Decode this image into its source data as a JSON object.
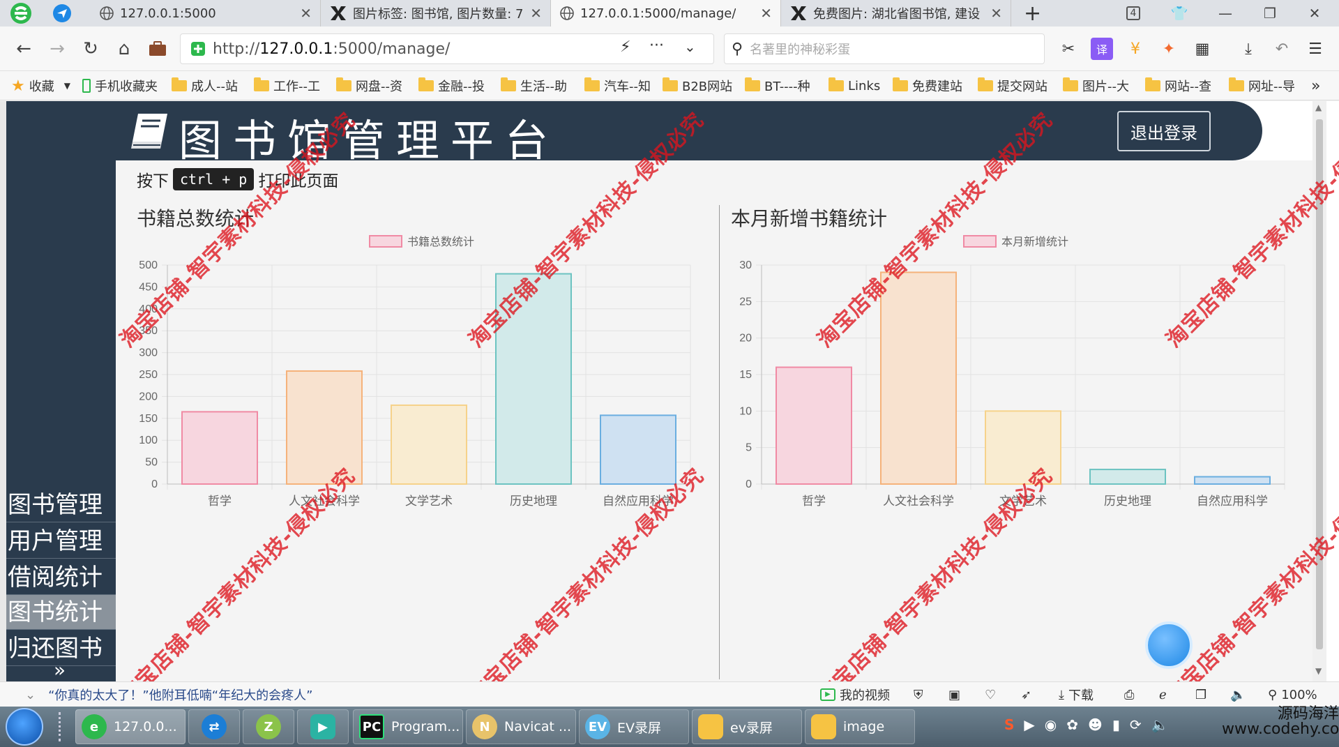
{
  "browser": {
    "tabs": [
      {
        "label": "127.0.0.1:5000",
        "icon": "globe-icon"
      },
      {
        "label": "图片标签: 图书馆, 图片数量: 7",
        "icon": "site-logo-icon"
      },
      {
        "label": "127.0.0.1:5000/manage/",
        "icon": "globe-icon"
      },
      {
        "label": "免费图片: 湖北省图书馆, 建设",
        "icon": "site-logo-icon"
      }
    ],
    "tab_counter": "4",
    "url_prefix": "http://",
    "url_host": "127.0.0.1",
    "url_rest": ":5000/manage/",
    "search_placeholder": "名著里的神秘彩蛋",
    "bookmarks": [
      "收藏",
      "手机收藏夹",
      "成人--站",
      "工作--工",
      "网盘--资",
      "金融--投",
      "生活--助",
      "汽车--知",
      "B2B网站",
      "BT----种",
      "Links",
      "免费建站",
      "提交网站",
      "图片--大",
      "网站--查",
      "网址--导"
    ],
    "bookmarks_more": "»"
  },
  "app": {
    "title": "图书馆管理平台",
    "logout_label": "退出登录",
    "sidebar": [
      "图书管理",
      "用户管理",
      "借阅统计",
      "图书统计",
      "归还图书"
    ],
    "sidebar_active_index": 3,
    "print_prefix": "按下",
    "print_key": "ctrl + p",
    "print_suffix": "打印此页面",
    "panels": [
      "书籍总数统计",
      "本月新增书籍统计"
    ]
  },
  "chart_data": [
    {
      "type": "bar",
      "categories": [
        "哲学",
        "人文社会科学",
        "文学艺术",
        "历史地理",
        "自然应用科学"
      ],
      "series": [
        {
          "name": "书籍总数统计",
          "values": [
            165,
            258,
            180,
            480,
            157
          ]
        }
      ],
      "ylim": [
        0,
        500
      ],
      "yticks": [
        0,
        50,
        100,
        150,
        200,
        250,
        300,
        350,
        400,
        450,
        500
      ],
      "grid": true,
      "legend": "top",
      "colors": {
        "fill": [
          "#f7d6df",
          "#f8e2cf",
          "#f9ecd1",
          "#d2eaea",
          "#cfe1f2"
        ],
        "stroke": [
          "#f08aa4",
          "#f5b27a",
          "#f6d28a",
          "#6cc3c1",
          "#6aaee0"
        ]
      }
    },
    {
      "type": "bar",
      "categories": [
        "哲学",
        "人文社会科学",
        "文学艺术",
        "历史地理",
        "自然应用科学"
      ],
      "series": [
        {
          "name": "本月新增统计",
          "values": [
            16,
            29,
            10,
            2,
            1
          ]
        }
      ],
      "ylim": [
        0,
        30
      ],
      "yticks": [
        0,
        5,
        10,
        15,
        20,
        25,
        30
      ],
      "grid": true,
      "legend": "top",
      "colors": {
        "fill": [
          "#f7d6df",
          "#f8e2cf",
          "#f9ecd1",
          "#d2eaea",
          "#cfe1f2"
        ],
        "stroke": [
          "#f08aa4",
          "#f5b27a",
          "#f6d28a",
          "#6cc3c1",
          "#6aaee0"
        ]
      }
    }
  ],
  "watermark": "淘宝店铺-智宇素材科技-侵权必究",
  "statusbar": {
    "headline": "“你真的太大了！”他附耳低喃“年纪大的会疼人”",
    "my_video": "我的视频",
    "download": "下载",
    "zoom": "100%"
  },
  "taskbar": {
    "tasks": [
      "127.0.0...",
      "",
      "",
      "",
      "Program...",
      "Navicat ...",
      "EV录屏",
      "ev录屏",
      "image"
    ],
    "tray_line1": "源码海洋网",
    "tray_line2": "www.codehy.com"
  }
}
